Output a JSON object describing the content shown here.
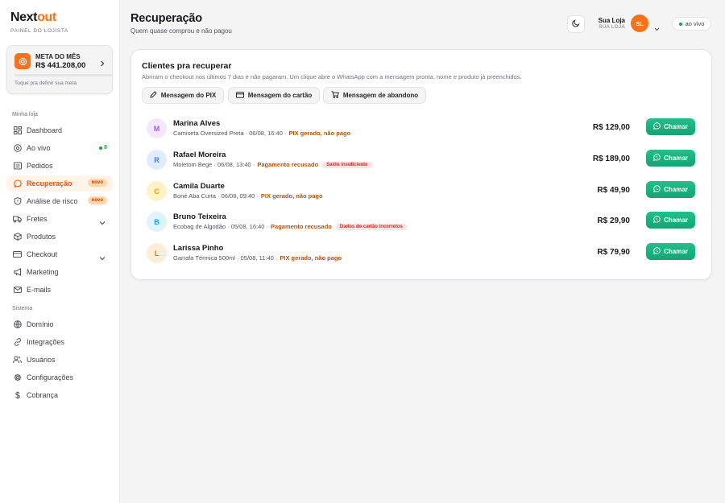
{
  "brand": {
    "name_main": "Next",
    "name_accent": "out",
    "subtitle": "PAINEL DO LOJISTA"
  },
  "goal": {
    "label": "META DO MÊS",
    "value": "R$ 441.208,00",
    "hint": "Toque pra definir sua meta",
    "progress": 0
  },
  "sidebar": {
    "section_store": "Minha loja",
    "section_system": "Sistema",
    "items": [
      {
        "label": "Dashboard",
        "icon": "grid-icon"
      },
      {
        "label": "Ao vivo",
        "icon": "target-icon",
        "count": "8"
      },
      {
        "label": "Pedidos",
        "icon": "list-icon"
      },
      {
        "label": "Recuperação",
        "icon": "chat-icon",
        "badge": "novo",
        "active": true
      },
      {
        "label": "Análise de risco",
        "icon": "shield-icon",
        "badge": "novo"
      },
      {
        "label": "Fretes",
        "icon": "truck-icon"
      },
      {
        "label": "Produtos",
        "icon": "box-icon"
      },
      {
        "label": "Checkout",
        "icon": "card-icon"
      },
      {
        "label": "Marketing",
        "icon": "megaphone-icon"
      },
      {
        "label": "E-mails",
        "icon": "mail-icon"
      }
    ],
    "system_items": [
      {
        "label": "Domínio",
        "icon": "globe-icon"
      },
      {
        "label": "Integrações",
        "icon": "link-icon"
      },
      {
        "label": "Usuários",
        "icon": "users-icon"
      },
      {
        "label": "Configurações",
        "icon": "gear-icon"
      },
      {
        "label": "Cobrança",
        "icon": "dollar-icon"
      }
    ]
  },
  "header": {
    "title": "Recuperação",
    "subtitle": "Quem quase comprou e não pagou",
    "store_name": "Sua Loja",
    "store_sub": "SUA LOJA",
    "avatar_initials": "SL",
    "live_label": "ao vivo"
  },
  "card": {
    "title": "Clientes pra recuperar",
    "description": "Abriram o checkout nos últimos 7 dias e não pagaram. Um clique abre o WhatsApp com a mensagem pronta, nome e produto já preenchidos.",
    "chips": [
      "Mensagem do PIX",
      "Mensagem do cartão",
      "Mensagem de abandono"
    ],
    "call_label": "Chamar",
    "customers": [
      {
        "initial": "M",
        "name": "Marina Alves",
        "product": "Camiseta Oversized Preta · 06/08, 16:40 ·",
        "status": "PIX gerado, não pago",
        "reason": "",
        "price": "R$ 129,00",
        "bg": "#f3e8ff",
        "fg": "#a855f7"
      },
      {
        "initial": "R",
        "name": "Rafael Moreira",
        "product": "Moletom Bege · 06/08, 13:40 ·",
        "status": "Pagamento recusado",
        "reason": "Saldo insuficiente",
        "price": "R$ 189,00",
        "bg": "#e0ecff",
        "fg": "#3b82f6"
      },
      {
        "initial": "C",
        "name": "Camila Duarte",
        "product": "Boné Aba Curta · 06/08, 09:40 ·",
        "status": "PIX gerado, não pago",
        "reason": "",
        "price": "R$ 49,90",
        "bg": "#fef3c7",
        "fg": "#f59e0b"
      },
      {
        "initial": "B",
        "name": "Bruno Teixeira",
        "product": "Ecobag de Algodão · 05/08, 16:40 ·",
        "status": "Pagamento recusado",
        "reason": "Dados do cartão incorretos",
        "price": "R$ 29,90",
        "bg": "#dff3fc",
        "fg": "#0ea5e9"
      },
      {
        "initial": "L",
        "name": "Larissa Pinho",
        "product": "Garrafa Térmica 500ml · 05/08, 11:40 ·",
        "status": "PIX gerado, não pago",
        "reason": "",
        "price": "R$ 79,90",
        "bg": "#ffedd5",
        "fg": "#f97316"
      }
    ]
  },
  "colors": {
    "accent": "#f97316",
    "whatsapp": "#16a374",
    "live": "#16a34a",
    "warning": "#b45309",
    "danger": "#dc2626"
  }
}
